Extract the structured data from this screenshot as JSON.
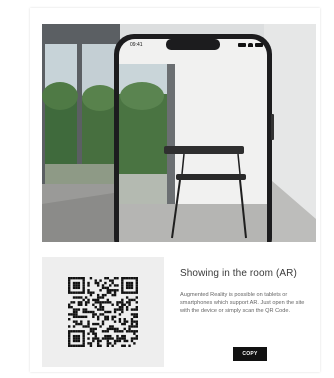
{
  "phone": {
    "status_time": "09:41",
    "status_icons": [
      "signal-icon",
      "wifi-icon",
      "battery-icon"
    ]
  },
  "ar_section": {
    "title": "Showing in the room (AR)",
    "description": "Augmented Reality is possible on tablets or smartphones which support AR. Just open the site with the device or simply scan the QR Code.",
    "button_label": "COPY"
  }
}
